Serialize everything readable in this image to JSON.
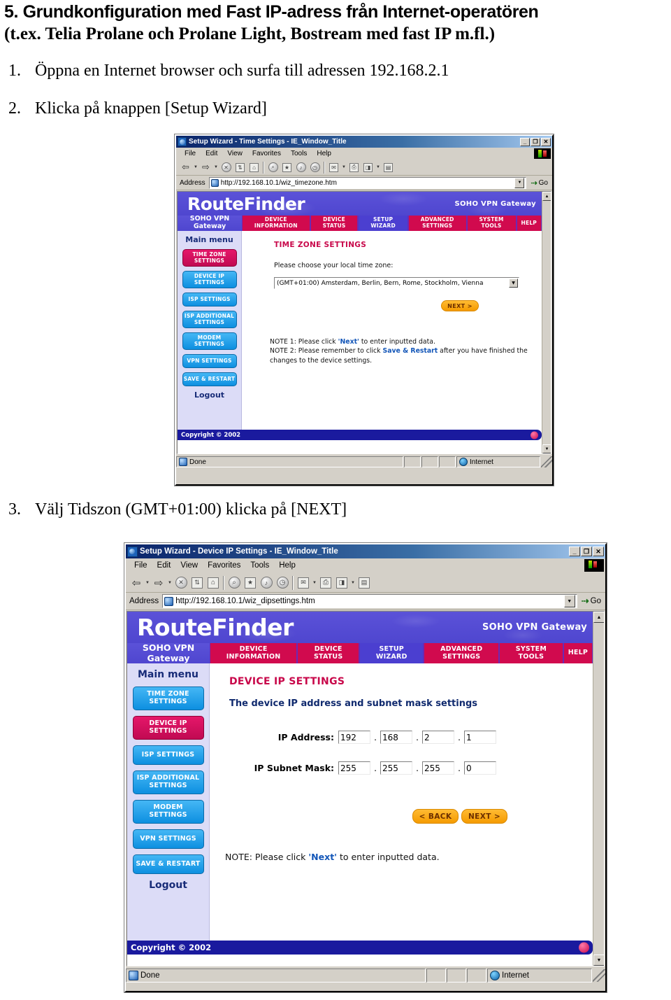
{
  "doc": {
    "heading_line1": "5. Grundkonfiguration med Fast IP-adress från Internet-operatören",
    "heading_line2": "(t.ex. Telia Prolane och Prolane Light, Bostream med fast IP m.fl.)",
    "steps": [
      {
        "num": "1.",
        "text": "Öppna en Internet browser och surfa till adressen 192.168.2.1"
      },
      {
        "num": "2.",
        "text": "Klicka på knappen [Setup Wizard]"
      },
      {
        "num": "3.",
        "text": "Välj Tidszon (GMT+01:00) klicka på [NEXT]"
      }
    ]
  },
  "colors": {
    "banner_purple": "#5b52d8",
    "tab_crimson": "#d10a4e",
    "tab_active_blue": "#4b3fd0",
    "sidebar_blue": "#0d8fe0",
    "sidebar_active_pink": "#c10a52",
    "section_title_pink": "#c8074a",
    "copyright_navy": "#1a1a9e",
    "button_orange": "#f59b00",
    "titlebar_blue": "#0a246a"
  },
  "window1": {
    "title": "Setup Wizard - Time Settings - IE_Window_Title",
    "title_icon": "ie-document-icon",
    "window_buttons": [
      {
        "name": "minimize-button",
        "glyph": "_"
      },
      {
        "name": "maximize-button",
        "glyph": "❐"
      },
      {
        "name": "close-button",
        "glyph": "✕"
      }
    ],
    "menus": [
      "File",
      "Edit",
      "View",
      "Favorites",
      "Tools",
      "Help"
    ],
    "toolbar_icons": [
      "back-icon",
      "back-dropdown-icon",
      "forward-icon",
      "forward-dropdown-icon",
      "stop-icon",
      "refresh-icon",
      "home-icon",
      "search-icon",
      "favorites-icon",
      "media-icon",
      "history-icon",
      "mail-icon",
      "mail-dropdown-icon",
      "print-icon",
      "edit-icon",
      "edit-dropdown-icon",
      "discuss-icon"
    ],
    "address": {
      "label": "Address",
      "value": "http://192.168.10.1/wiz_timezone.htm",
      "go_label": "Go"
    },
    "brand": {
      "logo": "RouteFinder",
      "tagline": "SOHO VPN Gateway",
      "sub_line1": "SOHO VPN",
      "sub_line2": "Gateway"
    },
    "nav_tabs": [
      {
        "line1": "DEVICE",
        "line2": "INFORMATION",
        "active": false
      },
      {
        "line1": "DEVICE",
        "line2": "STATUS",
        "active": false
      },
      {
        "line1": "SETUP",
        "line2": "WIZARD",
        "active": true
      },
      {
        "line1": "ADVANCED",
        "line2": "SETTINGS",
        "active": false
      },
      {
        "line1": "SYSTEM",
        "line2": "TOOLS",
        "active": false
      },
      {
        "line1": "HELP",
        "line2": "",
        "active": false
      }
    ],
    "sidebar": {
      "title": "Main menu",
      "items": [
        {
          "line1": "TIME ZONE",
          "line2": "SETTINGS",
          "active": true
        },
        {
          "line1": "DEVICE IP",
          "line2": "SETTINGS",
          "active": false
        },
        {
          "line1": "ISP SETTINGS",
          "line2": "",
          "active": false
        },
        {
          "line1": "ISP ADDITIONAL",
          "line2": "SETTINGS",
          "active": false
        },
        {
          "line1": "MODEM",
          "line2": "SETTINGS",
          "active": false
        },
        {
          "line1": "VPN SETTINGS",
          "line2": "",
          "active": false
        },
        {
          "line1": "SAVE & RESTART",
          "line2": "",
          "active": false
        }
      ],
      "logout": "Logout"
    },
    "content": {
      "section_title": "TIME ZONE SETTINGS",
      "prompt": "Please choose your local time zone:",
      "timezone_selected": "(GMT+01:00) Amsterdam, Berlin, Bern, Rome, Stockholm, Vienna",
      "next_label": "NEXT >",
      "note1_prefix": "NOTE 1: Please click ",
      "note1_strong": "'Next'",
      "note1_suffix": " to enter inputted data.",
      "note2_prefix": "NOTE 2: Please remember to click ",
      "note2_strong": "Save & Restart",
      "note2_suffix": " after you have finished the changes to the device settings."
    },
    "copyright": "Copyright © 2002",
    "statusbar": {
      "status": "Done",
      "zone": "Internet"
    }
  },
  "window2": {
    "title": "Setup Wizard - Device IP Settings - IE_Window_Title",
    "title_icon": "ie-document-icon",
    "window_buttons": [
      {
        "name": "minimize-button",
        "glyph": "_"
      },
      {
        "name": "maximize-button",
        "glyph": "❐"
      },
      {
        "name": "close-button",
        "glyph": "✕"
      }
    ],
    "menus": [
      "File",
      "Edit",
      "View",
      "Favorites",
      "Tools",
      "Help"
    ],
    "address": {
      "label": "Address",
      "value": "http://192.168.10.1/wiz_dipsettings.htm",
      "go_label": "Go"
    },
    "brand": {
      "logo": "RouteFinder",
      "tagline": "SOHO VPN Gateway",
      "sub_line1": "SOHO VPN",
      "sub_line2": "Gateway"
    },
    "nav_tabs": [
      {
        "line1": "DEVICE",
        "line2": "INFORMATION",
        "active": false
      },
      {
        "line1": "DEVICE",
        "line2": "STATUS",
        "active": false
      },
      {
        "line1": "SETUP",
        "line2": "WIZARD",
        "active": true
      },
      {
        "line1": "ADVANCED",
        "line2": "SETTINGS",
        "active": false
      },
      {
        "line1": "SYSTEM",
        "line2": "TOOLS",
        "active": false
      },
      {
        "line1": "HELP",
        "line2": "",
        "active": false
      }
    ],
    "sidebar": {
      "title": "Main menu",
      "items": [
        {
          "line1": "TIME ZONE",
          "line2": "SETTINGS",
          "active": false
        },
        {
          "line1": "DEVICE IP",
          "line2": "SETTINGS",
          "active": true
        },
        {
          "line1": "ISP SETTINGS",
          "line2": "",
          "active": false
        },
        {
          "line1": "ISP ADDITIONAL",
          "line2": "SETTINGS",
          "active": false
        },
        {
          "line1": "MODEM",
          "line2": "SETTINGS",
          "active": false
        },
        {
          "line1": "VPN SETTINGS",
          "line2": "",
          "active": false
        },
        {
          "line1": "SAVE & RESTART",
          "line2": "",
          "active": false
        }
      ],
      "logout": "Logout"
    },
    "content": {
      "section_title": "DEVICE IP SETTINGS",
      "subtitle": "The device IP address and subnet mask settings",
      "ip_address_label": "IP Address:",
      "ip_address_octets": [
        "192",
        "168",
        "2",
        "1"
      ],
      "subnet_label": "IP Subnet Mask:",
      "subnet_octets": [
        "255",
        "255",
        "255",
        "0"
      ],
      "back_label": "< BACK",
      "next_label": "NEXT >",
      "note_prefix": "NOTE: Please click ",
      "note_strong": "'Next'",
      "note_suffix": " to enter inputted data."
    },
    "copyright": "Copyright © 2002",
    "statusbar": {
      "status": "Done",
      "zone": "Internet"
    }
  }
}
